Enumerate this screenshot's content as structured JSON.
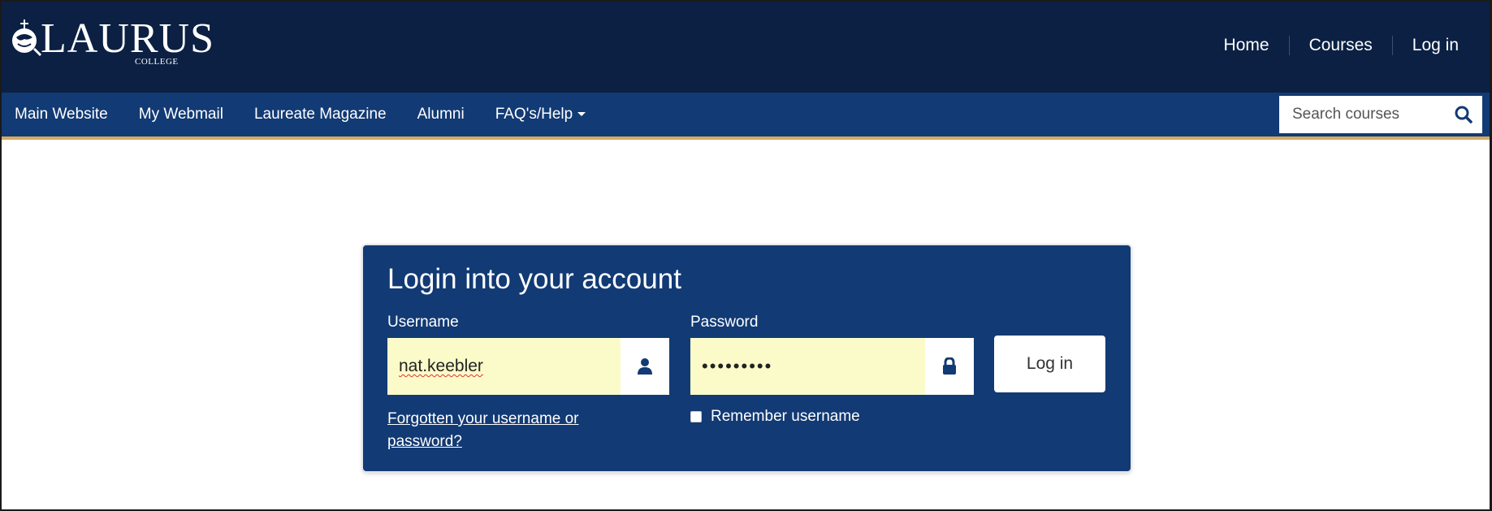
{
  "header": {
    "logo_text": "LAURUS",
    "logo_subtext": "COLLEGE",
    "nav": [
      {
        "label": "Home"
      },
      {
        "label": "Courses"
      },
      {
        "label": "Log in"
      }
    ]
  },
  "subnav": {
    "items": [
      {
        "label": "Main Website"
      },
      {
        "label": "My Webmail"
      },
      {
        "label": "Laureate Magazine"
      },
      {
        "label": "Alumni"
      },
      {
        "label": "FAQ's/Help",
        "has_dropdown": true
      }
    ],
    "search": {
      "placeholder": "Search courses",
      "icon": "search-icon"
    }
  },
  "login": {
    "title": "Login into your account",
    "username_label": "Username",
    "username_value": "nat.keebler",
    "username_icon": "user-icon",
    "password_label": "Password",
    "password_value": "•••••••••",
    "password_icon": "lock-icon",
    "submit_label": "Log in",
    "forgot_link": "Forgotten your username or password?",
    "remember_label": "Remember username",
    "remember_checked": false
  },
  "colors": {
    "header_bg": "#0b2043",
    "subnav_bg": "#123a74",
    "accent_border": "#d5a961",
    "card_bg": "#123a74",
    "autofill_bg": "#fafbc9"
  }
}
